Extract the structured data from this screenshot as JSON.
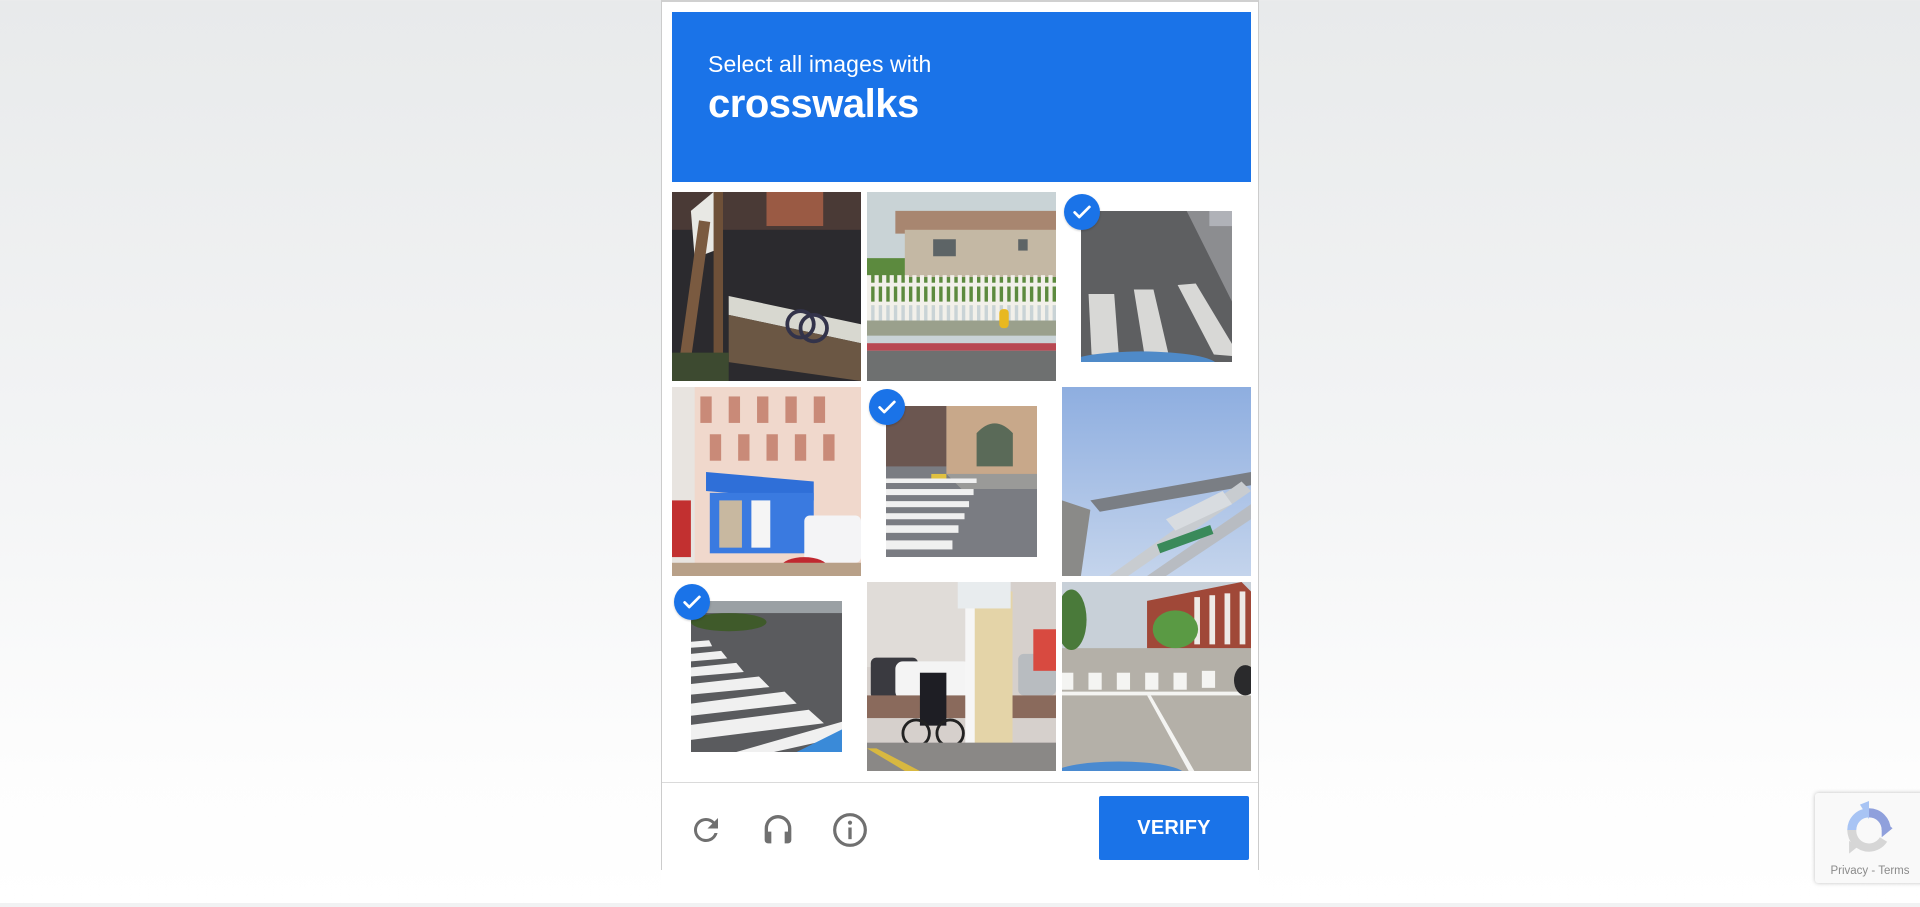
{
  "challenge": {
    "prompt": "Select all images with",
    "target": "crosswalks",
    "accent_color": "#1a73e8",
    "tiles": [
      {
        "index": 1,
        "description": "bridge with bicycles under flag pole",
        "selected": false
      },
      {
        "index": 2,
        "description": "house with white picket fence and yellow fire hydrant",
        "selected": false
      },
      {
        "index": 3,
        "description": "road with crosswalk stripes",
        "selected": true
      },
      {
        "index": 4,
        "description": "street with shop front and parked van",
        "selected": false
      },
      {
        "index": 5,
        "description": "crosswalk in front of building entrance",
        "selected": true
      },
      {
        "index": 6,
        "description": "metal structure against sky",
        "selected": false
      },
      {
        "index": 7,
        "description": "curved crosswalk at intersection",
        "selected": true
      },
      {
        "index": 8,
        "description": "cyclist next to utility pole and signs",
        "selected": false
      },
      {
        "index": 9,
        "description": "intersection with crosswalk and brick building",
        "selected": true
      }
    ]
  },
  "footer": {
    "reload_icon": "reload-icon",
    "audio_icon": "headphones-icon",
    "info_icon": "info-icon",
    "verify_label": "VERIFY"
  },
  "badge": {
    "privacy_label": "Privacy",
    "separator": " - ",
    "terms_label": "Terms"
  }
}
